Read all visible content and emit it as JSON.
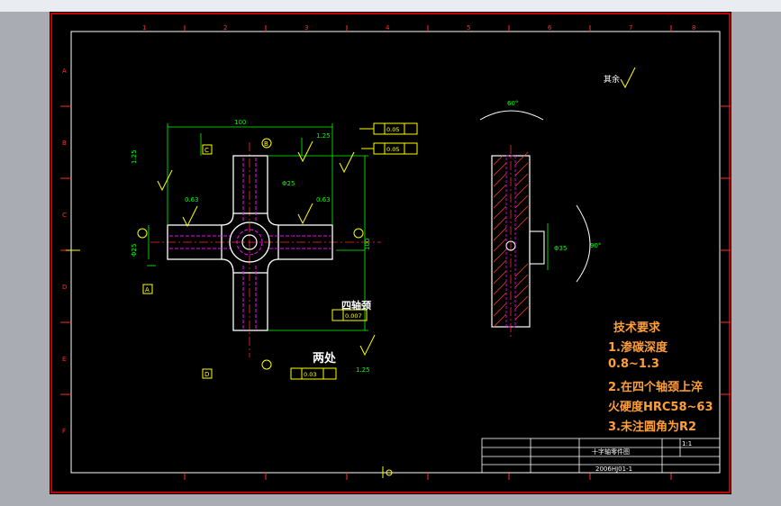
{
  "top_strip": "",
  "roughness_note": "其余",
  "dim_width": "100",
  "dim_height": "100",
  "dim_chamfer": "1.25",
  "tolerance_frames": [
    "0.05",
    "0.05",
    "0.007",
    "0.03"
  ],
  "datum_labels": [
    "A",
    "B",
    "C",
    "D"
  ],
  "roughness_values": [
    "0.63",
    "0.63",
    "1.25",
    "1.25"
  ],
  "dia_center": "Φ25",
  "dia_side": "Φ25",
  "label_four_necks": "四轴颈",
  "label_two_places": "两处",
  "section_dims": [
    "60°",
    "90°",
    "Φ35"
  ],
  "technical_requirements": {
    "title": "技术要求",
    "items": [
      "1.渗碳深度",
      "0.8~1.3",
      "2.在四个轴颈上淬",
      "火硬度HRC58~63",
      "3.未注圆角为R2"
    ]
  },
  "title_block": {
    "part_name": "十字轴零件图",
    "scale": "1:1",
    "drawing_no": "2006HJ01-1"
  },
  "border_zones_top": [
    "1",
    "2",
    "3",
    "4",
    "5",
    "6",
    "7",
    "8"
  ],
  "border_zones_side": [
    "A",
    "B",
    "C",
    "D",
    "E",
    "F"
  ],
  "colors": {
    "background": "#000000",
    "frame": "#ff0000",
    "sheet_border": "#ffffff",
    "part_outline": "#ffffff",
    "hidden_lines": "#ff00ff",
    "dimensions": "#00ff00",
    "annotations": "#ffff00",
    "hatch": "#ff3b2b",
    "notes": "#ff9f3a",
    "center_lines": "#ff2d2d"
  }
}
